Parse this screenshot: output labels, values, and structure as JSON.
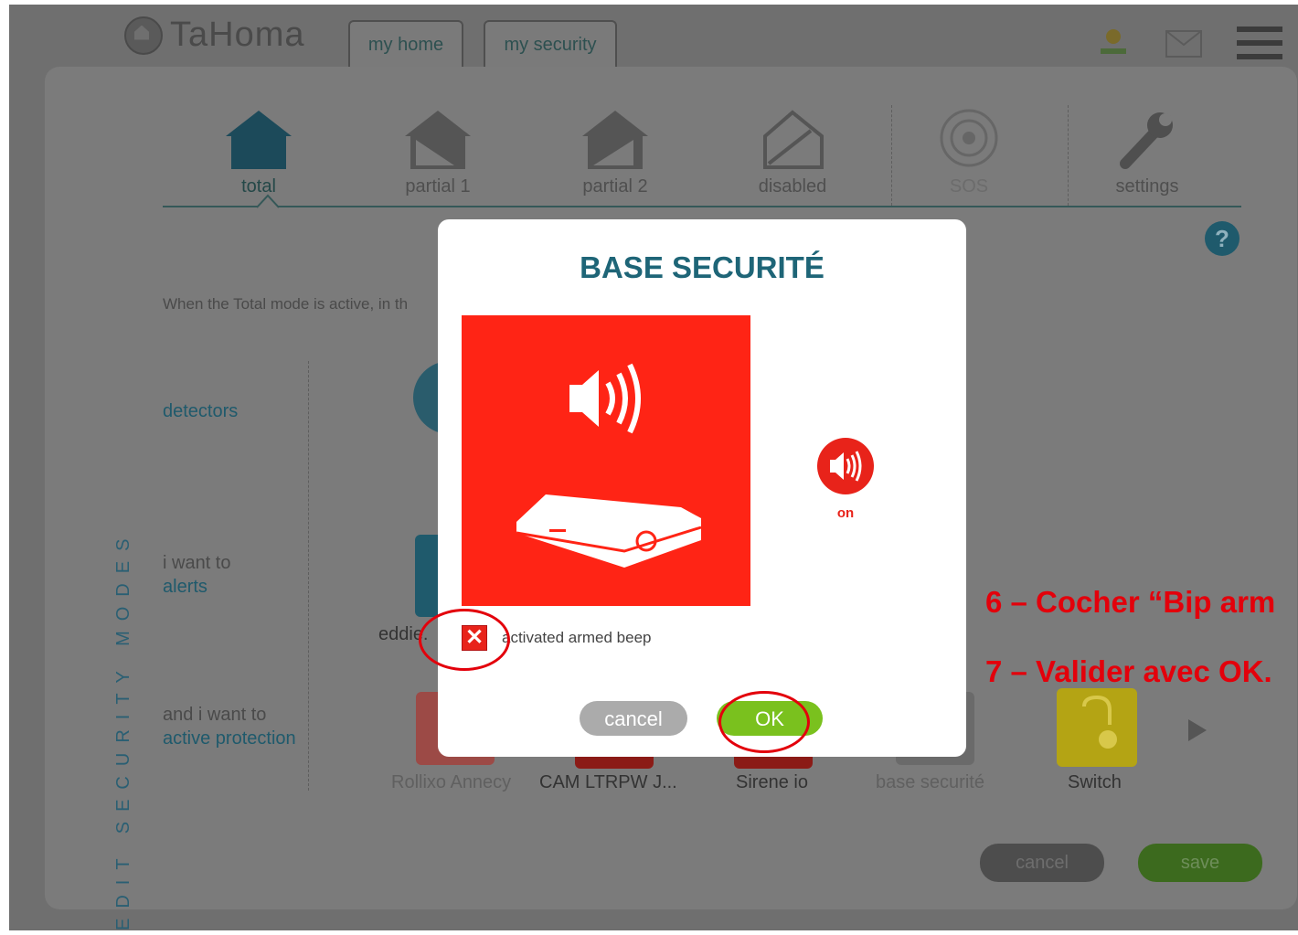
{
  "app": {
    "brand": "TaHoma",
    "tabs": [
      "my home",
      "my security"
    ]
  },
  "modes": [
    {
      "label": "total",
      "icon": "house-filled-icon"
    },
    {
      "label": "partial 1",
      "icon": "house-partial-icon"
    },
    {
      "label": "partial 2",
      "icon": "house-partial-icon"
    },
    {
      "label": "disabled",
      "icon": "house-outline-icon"
    },
    {
      "label": "SOS",
      "icon": "target-icon"
    },
    {
      "label": "settings",
      "icon": "wrench-icon"
    }
  ],
  "help": "?",
  "side_title": "EDIT SECURITY MODES",
  "description": "When the Total mode is active, in th",
  "rows": {
    "detectors": "detectors",
    "alerts_pre": "i want to",
    "alerts": "alerts",
    "protection_pre": "and i want to",
    "protection": "active protection"
  },
  "alert_device": "eddie.",
  "devices": [
    "Rollixo Annecy",
    "CAM LTRPW J...",
    "Sirene io",
    "base securité",
    "Switch"
  ],
  "footer": {
    "cancel": "cancel",
    "save": "save"
  },
  "modal": {
    "title": "BASE SECURITÉ",
    "state": "on",
    "checkbox_mark": "✕",
    "checkbox_label": "activated armed beep",
    "cancel": "cancel",
    "ok": "OK"
  },
  "annotations": [
    "6 – Cocher “Bip arm",
    "7 – Valider avec OK."
  ],
  "colors": {
    "accent": "#1f5a6c",
    "alert_red": "#e3000b",
    "ok_green": "#7ac11e",
    "device_red": "#ff2415"
  }
}
